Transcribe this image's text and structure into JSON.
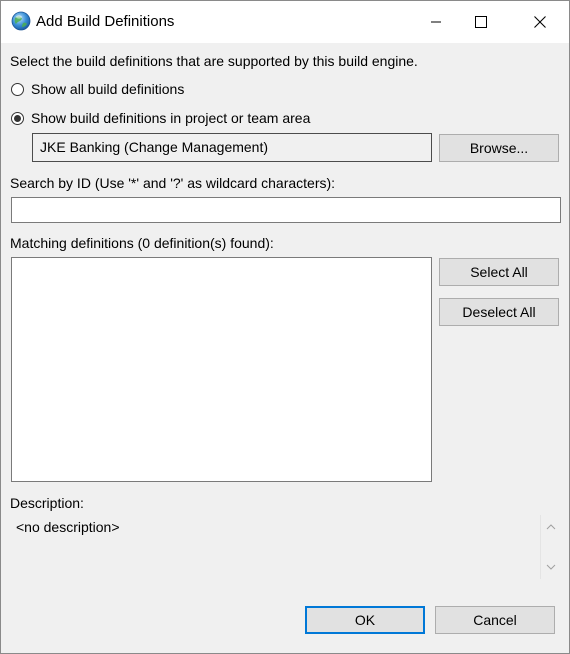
{
  "dialog": {
    "title": "Add Build Definitions",
    "intro": "Select the build definitions that are supported by this build engine.",
    "radio_all_label": "Show all build definitions",
    "radio_all_checked": false,
    "radio_project_label": "Show build definitions in project or team area",
    "radio_project_checked": true,
    "project_area_value": "JKE Banking (Change Management)",
    "browse_label": "Browse...",
    "search_label": "Search by ID (Use '*' and '?' as wildcard characters):",
    "search_value": "",
    "matching_label": "Matching definitions (0 definition(s) found):",
    "matching_items": [],
    "select_all_label": "Select All",
    "deselect_all_label": "Deselect All",
    "description_label": "Description:",
    "description_value": "<no description>",
    "ok_label": "OK",
    "cancel_label": "Cancel"
  },
  "icons": {
    "app": "globe-icon",
    "minimize": "minimize-icon",
    "maximize": "maximize-icon",
    "close": "close-icon",
    "scroll_up": "chevron-up-icon",
    "scroll_down": "chevron-down-icon"
  },
  "colors": {
    "window_bg": "#f0f0f0",
    "titlebar_bg": "#ffffff",
    "default_button_border": "#0078d7"
  }
}
